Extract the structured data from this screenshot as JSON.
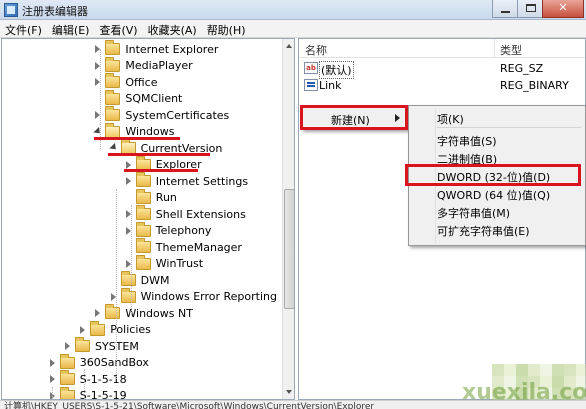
{
  "window": {
    "title": "注册表编辑器",
    "controls": {
      "minimize": "",
      "maximize": "",
      "close": "✕"
    }
  },
  "menubar": [
    "文件(F)",
    "编辑(E)",
    "查看(V)",
    "收藏夹(A)",
    "帮助(H)"
  ],
  "tree": {
    "rows": [
      {
        "label": "Internet Explorer",
        "indent": 7,
        "expander": "closed",
        "open": false
      },
      {
        "label": "MediaPlayer",
        "indent": 7,
        "expander": "closed",
        "open": false
      },
      {
        "label": "Office",
        "indent": 7,
        "expander": "closed",
        "open": false
      },
      {
        "label": "SQMClient",
        "indent": 7,
        "expander": "none",
        "open": false
      },
      {
        "label": "SystemCertificates",
        "indent": 7,
        "expander": "closed",
        "open": false
      },
      {
        "label": "Windows",
        "indent": 7,
        "expander": "open",
        "open": true
      },
      {
        "label": "CurrentVersion",
        "indent": 8,
        "expander": "open",
        "open": true
      },
      {
        "label": "Explorer",
        "indent": 9,
        "expander": "closed",
        "open": false,
        "selected": true
      },
      {
        "label": "Internet Settings",
        "indent": 9,
        "expander": "closed",
        "open": false
      },
      {
        "label": "Run",
        "indent": 9,
        "expander": "none",
        "open": false
      },
      {
        "label": "Shell Extensions",
        "indent": 9,
        "expander": "closed",
        "open": false
      },
      {
        "label": "Telephony",
        "indent": 9,
        "expander": "closed",
        "open": false
      },
      {
        "label": "ThemeManager",
        "indent": 9,
        "expander": "none",
        "open": false
      },
      {
        "label": "WinTrust",
        "indent": 9,
        "expander": "closed",
        "open": false
      },
      {
        "label": "DWM",
        "indent": 8,
        "expander": "none",
        "open": false
      },
      {
        "label": "Windows Error Reporting",
        "indent": 8,
        "expander": "closed",
        "open": false
      },
      {
        "label": "Windows NT",
        "indent": 7,
        "expander": "closed",
        "open": false
      },
      {
        "label": "Policies",
        "indent": 6,
        "expander": "closed",
        "open": false
      },
      {
        "label": "SYSTEM",
        "indent": 5,
        "expander": "closed",
        "open": false
      },
      {
        "label": "360SandBox",
        "indent": 4,
        "expander": "closed",
        "open": false
      },
      {
        "label": "S-1-5-18",
        "indent": 4,
        "expander": "closed",
        "open": false
      },
      {
        "label": "S-1-5-19",
        "indent": 4,
        "expander": "closed",
        "open": false
      }
    ]
  },
  "list": {
    "columns": {
      "name": "名称",
      "type": "类型"
    },
    "rows": [
      {
        "icon": "ab",
        "name": "(默认)",
        "type": "REG_SZ",
        "focused": true
      },
      {
        "icon": "link",
        "name": "Link",
        "type": "REG_BINARY",
        "focused": false
      }
    ]
  },
  "context_menu": {
    "new_label": "新建(N)"
  },
  "submenu": {
    "items": [
      {
        "label": "项(K)",
        "sep_after": true
      },
      {
        "label": "字符串值(S)",
        "sep_after": false
      },
      {
        "label": "二进制值(B)",
        "sep_after": false
      },
      {
        "label": "DWORD (32-位)值(D)",
        "sep_after": false,
        "highlighted": true
      },
      {
        "label": "QWORD (64 位)值(Q)",
        "sep_after": false
      },
      {
        "label": "多字符串值(M)",
        "sep_after": false
      },
      {
        "label": "可扩充字符串值(E)",
        "sep_after": false
      }
    ]
  },
  "statusbar": {
    "text": "计算机\\HKEY_USERS\\S-1-5-21\\Software\\Microsoft\\Windows\\CurrentVersion\\Explorer"
  },
  "watermark": {
    "text": "xuexila.com"
  },
  "colors": {
    "highlight_red": "#d9141e",
    "folder": "#eab94a",
    "watermark": "#6f9f3a"
  }
}
